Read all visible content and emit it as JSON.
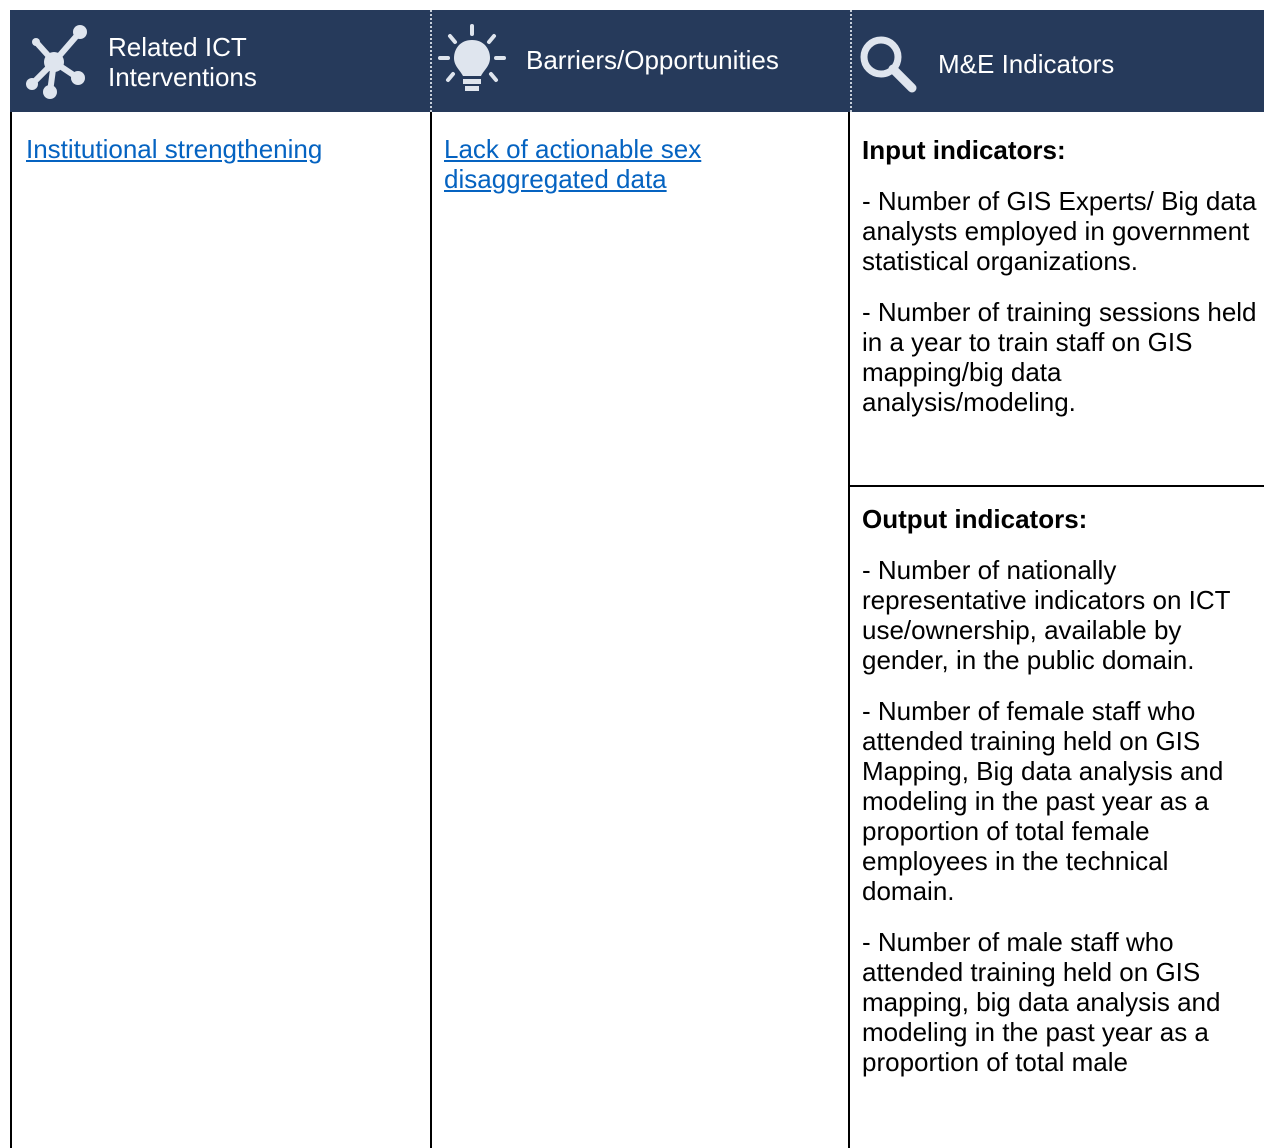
{
  "header": {
    "col1": {
      "label_line1": "Related ICT",
      "label_line2": "Interventions",
      "icon": "network-nodes-icon"
    },
    "col2": {
      "label": "Barriers/Opportunities",
      "icon": "lightbulb-icon"
    },
    "col3": {
      "label": "M&E Indicators",
      "icon": "magnifier-icon"
    }
  },
  "colors": {
    "header_bg": "#263a5b",
    "link": "#0563c1"
  },
  "row": {
    "intervention_link": "Institutional strengthening",
    "barrier_link": "Lack of actionable sex disaggregated data",
    "input_indicators": {
      "heading": "Input indicators:",
      "items": [
        "- Number of GIS Experts/ Big data analysts employed in government statistical organizations.",
        "- Number of training sessions held in a year to train staff on GIS mapping/big data analysis/modeling."
      ]
    },
    "output_indicators": {
      "heading": "Output indicators:",
      "items": [
        "- Number of nationally representative indicators on ICT use/ownership, available by gender, in the public domain.",
        "- Number of female staff who attended training held on GIS Mapping, Big data analysis and modeling in the past year as a proportion of total female employees in the technical domain.",
        "- Number of male staff who attended training held on GIS mapping, big data analysis and modeling in the past year as a proportion of total male"
      ]
    }
  }
}
